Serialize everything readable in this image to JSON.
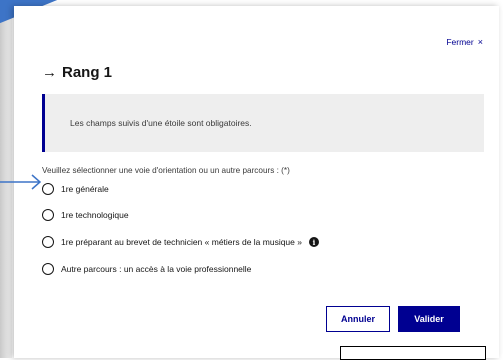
{
  "dialog": {
    "close_label": "Fermer",
    "close_icon": "×",
    "title_icon": "→",
    "title": "Rang 1"
  },
  "notice": {
    "text": "Les champs suivis d'une étoile sont obligatoires."
  },
  "form": {
    "legend": "Veuillez sélectionner une voie d'orientation ou un autre parcours : (*)",
    "options": [
      {
        "label": "1re générale",
        "selected": false
      },
      {
        "label": "1re technologique",
        "selected": false
      },
      {
        "label": "1re préparant au brevet de technicien « métiers de la musique »",
        "selected": false,
        "info_icon": "i"
      },
      {
        "label": "Autre parcours : un accès à la voie professionnelle",
        "selected": false
      }
    ]
  },
  "actions": {
    "cancel_label": "Annuler",
    "validate_label": "Valider"
  },
  "colors": {
    "primary": "#000091",
    "notice_bg": "#eeeeee",
    "annotation": "#3d74c7"
  }
}
